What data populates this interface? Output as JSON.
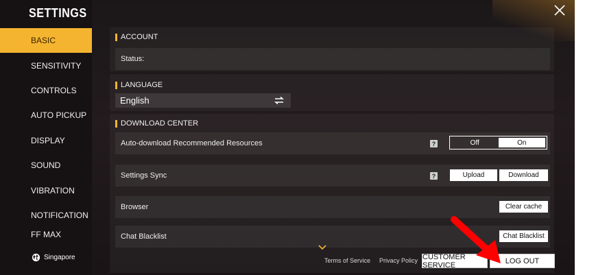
{
  "sidebar": {
    "title": "SETTINGS",
    "items": [
      {
        "label": "BASIC",
        "active": true
      },
      {
        "label": "SENSITIVITY"
      },
      {
        "label": "CONTROLS"
      },
      {
        "label": "AUTO PICKUP"
      },
      {
        "label": "DISPLAY"
      },
      {
        "label": "SOUND"
      },
      {
        "label": "VIBRATION"
      },
      {
        "label": "NOTIFICATION"
      },
      {
        "label": "FF MAX"
      }
    ],
    "region": "Singapore",
    "region_icon": "globe-icon"
  },
  "close_icon": "close-icon",
  "account": {
    "title": "ACCOUNT",
    "status_label": "Status:"
  },
  "language": {
    "title": "LANGUAGE",
    "selected": "English",
    "switch_icon": "swap-arrows-icon"
  },
  "download_center": {
    "title": "DOWNLOAD CENTER",
    "auto_download_label": "Auto-download Recommended Resources",
    "toggle": {
      "off_label": "Off",
      "on_label": "On",
      "value": "On"
    }
  },
  "settings_sync": {
    "label": "Settings Sync",
    "upload_label": "Upload",
    "download_label": "Download"
  },
  "browser": {
    "label": "Browser",
    "clear_cache_label": "Clear cache"
  },
  "chat_blacklist": {
    "label": "Chat Blacklist",
    "button_label": "Chat Blacklist"
  },
  "help_glyph": "?",
  "footer": {
    "terms_label": "Terms of Service",
    "privacy_label": "Privacy Policy",
    "customer_service_label": "CUSTOMER SERVICE",
    "logout_label": "LOG OUT"
  },
  "colors": {
    "accent": "#f5b430",
    "annotation_arrow": "#ff0000"
  }
}
